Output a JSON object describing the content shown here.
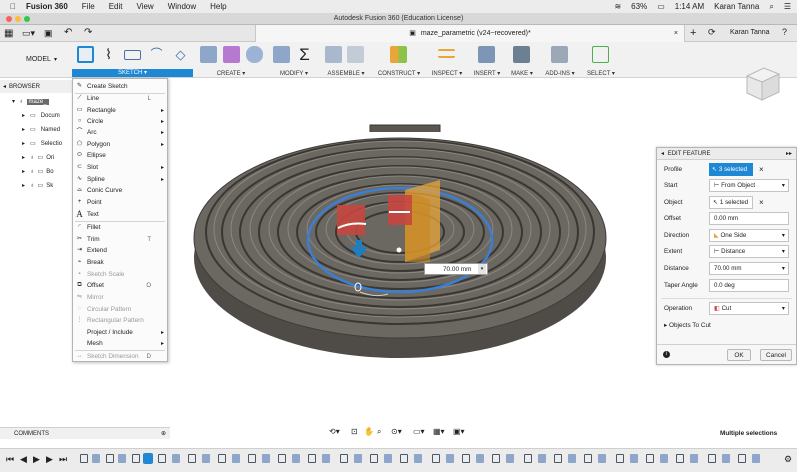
{
  "menubar": {
    "app_name": "Fusion 360",
    "items": [
      "File",
      "Edit",
      "View",
      "Window",
      "Help"
    ],
    "battery": "63%",
    "time": "1:14 AM",
    "user": "Karan Tanna"
  },
  "titlebar": {
    "title": "Autodesk Fusion 360 (Education License)"
  },
  "tabrow": {
    "doc_tab": "maze_parametric (v24~recovered)*",
    "user": "Karan Tanna"
  },
  "toolbar": {
    "workspace": "MODEL",
    "groups": {
      "sketch": "SKETCH ▾",
      "create": "CREATE ▾",
      "modify": "MODIFY ▾",
      "assemble": "ASSEMBLE ▾",
      "construct": "CONSTRUCT ▾",
      "inspect": "INSPECT ▾",
      "insert": "INSERT ▾",
      "make": "MAKE ▾",
      "addins": "ADD-INS ▾",
      "select": "SELECT ▾"
    }
  },
  "browser": {
    "title": "BROWSER",
    "rows": [
      "maze_",
      "Docum",
      "Named",
      "Selectio",
      "Ori",
      "Bo",
      "Sk"
    ]
  },
  "sketch_menu": {
    "items": [
      {
        "label": "Create Sketch",
        "icon": "✎"
      },
      {
        "label": "Line",
        "icon": "⟋",
        "shortcut": "L"
      },
      {
        "label": "Rectangle",
        "icon": "▭",
        "arrow": "▸"
      },
      {
        "label": "Circle",
        "icon": "○",
        "arrow": "▸"
      },
      {
        "label": "Arc",
        "icon": "⌒",
        "arrow": "▸"
      },
      {
        "label": "Polygon",
        "icon": "⬠",
        "arrow": "▸"
      },
      {
        "label": "Ellipse",
        "icon": "⬭"
      },
      {
        "label": "Slot",
        "icon": "⊂",
        "arrow": "▸"
      },
      {
        "label": "Spline",
        "icon": "∿",
        "arrow": "▸"
      },
      {
        "label": "Conic Curve",
        "icon": "⌓"
      },
      {
        "label": "Point",
        "icon": "+"
      },
      {
        "label": "Text",
        "icon": "A"
      },
      {
        "label": "Fillet",
        "icon": "◜"
      },
      {
        "label": "Trim",
        "icon": "✂",
        "shortcut": "T"
      },
      {
        "label": "Extend",
        "icon": "⇥"
      },
      {
        "label": "Break",
        "icon": "⌁"
      },
      {
        "label": "Sketch Scale",
        "icon": "▪"
      },
      {
        "label": "Offset",
        "icon": "⧉",
        "shortcut": "O"
      },
      {
        "label": "Mirror",
        "icon": "⇋"
      },
      {
        "label": "Circular Pattern",
        "icon": "◌"
      },
      {
        "label": "Rectangular Pattern",
        "icon": "⋮"
      },
      {
        "label": "Project / Include",
        "icon": "",
        "arrow": "▸"
      },
      {
        "label": "Mesh",
        "icon": "",
        "arrow": "▸"
      },
      {
        "label": "Sketch Dimension",
        "icon": "↔",
        "shortcut": "D"
      }
    ]
  },
  "viewport": {
    "dimension_value": "70.00 mm"
  },
  "edit_feature": {
    "title": "EDIT FEATURE",
    "profile_label": "Profile",
    "profile_value": "3 selected",
    "start_label": "Start",
    "start_value": "From Object",
    "object_label": "Object",
    "object_value": "1 selected",
    "offset_label": "Offset",
    "offset_value": "0.00 mm",
    "direction_label": "Direction",
    "direction_value": "One Side",
    "extent_label": "Extent",
    "extent_value": "Distance",
    "distance_label": "Distance",
    "distance_value": "70.00 mm",
    "taper_label": "Taper Angle",
    "taper_value": "0.0 deg",
    "operation_label": "Operation",
    "operation_value": "Cut",
    "objects_to_cut": "Objects To Cut",
    "ok": "OK",
    "cancel": "Cancel"
  },
  "bottom": {
    "comments": "COMMENTS",
    "status": "Multiple selections"
  },
  "colors": {
    "accent_blue": "#1e88d4",
    "model_gray": "#6b6761",
    "selection_red": "#c7463f",
    "cut_orange": "#e8a53a",
    "ring_blue": "#3a7fd4"
  }
}
